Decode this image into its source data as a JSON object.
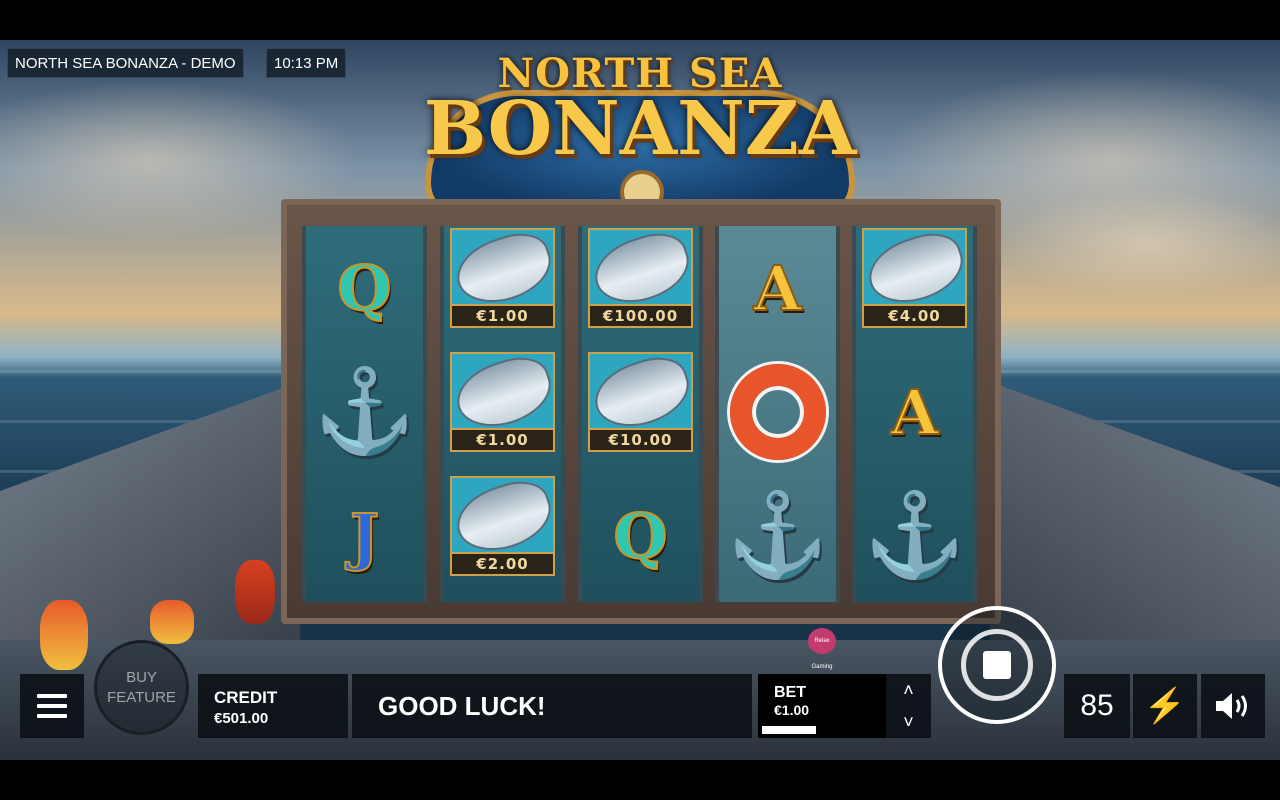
{
  "window": {
    "title": "NORTH SEA BONANZA - DEMO",
    "time": "10:13 PM"
  },
  "logo": {
    "line1": "NORTH SEA",
    "line2": "BONANZA"
  },
  "reels": [
    {
      "symbols": [
        {
          "type": "letter",
          "value": "Q"
        },
        {
          "type": "anchor",
          "icon": "anchor-icon"
        },
        {
          "type": "letter",
          "value": "J"
        }
      ]
    },
    {
      "symbols": [
        {
          "type": "fish",
          "value": "€1.00"
        },
        {
          "type": "fish",
          "value": "€1.00"
        },
        {
          "type": "fish",
          "value": "€2.00"
        }
      ]
    },
    {
      "symbols": [
        {
          "type": "fish",
          "value": "€100.00"
        },
        {
          "type": "fish",
          "value": "€10.00"
        },
        {
          "type": "letter",
          "value": "Q"
        }
      ]
    },
    {
      "symbols": [
        {
          "type": "letter",
          "value": "A"
        },
        {
          "type": "lifebuoy",
          "icon": "lifebuoy-icon"
        },
        {
          "type": "anchor",
          "icon": "anchor-icon"
        }
      ]
    },
    {
      "symbols": [
        {
          "type": "fish",
          "value": "€4.00"
        },
        {
          "type": "letter",
          "value": "A"
        },
        {
          "type": "anchor",
          "icon": "anchor-icon"
        }
      ]
    }
  ],
  "hud": {
    "buy_feature": "BUY FEATURE",
    "credit_label": "CREDIT",
    "credit_value": "€501.00",
    "message": "GOOD LUCK!",
    "bet_label": "BET",
    "bet_value": "€1.00",
    "autoplay_count": "85"
  },
  "provider_badge": "Relax Gaming",
  "colors": {
    "accent_gold": "#f6c240",
    "reel_teal": "#2f6c7a",
    "hud_bg": "#0c1016"
  }
}
